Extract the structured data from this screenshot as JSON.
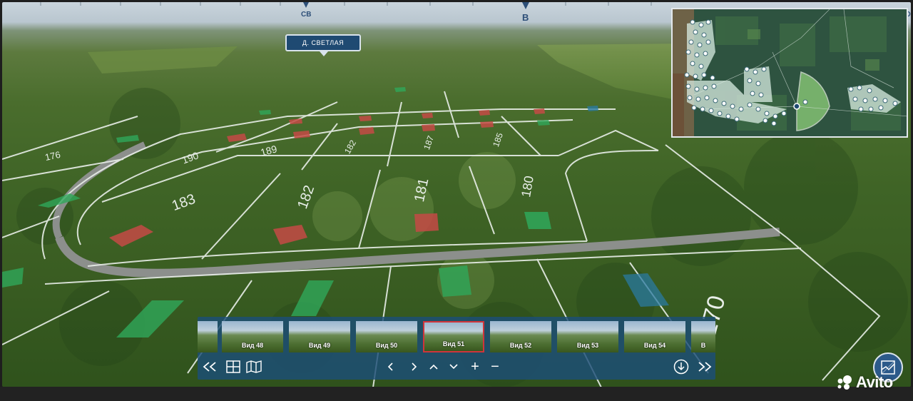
{
  "compass": {
    "ne_label": "СВ",
    "e_label": "В",
    "right_label": "О"
  },
  "village_label": "Д. СВЕТЛАЯ",
  "plot_numbers": [
    "180",
    "181",
    "182",
    "183",
    "189",
    "190",
    "176",
    "170",
    "185",
    "182",
    "187"
  ],
  "views": [
    {
      "label": ""
    },
    {
      "label": "Вид 48"
    },
    {
      "label": "Вид 49"
    },
    {
      "label": "Вид 50"
    },
    {
      "label": "Вид 51"
    },
    {
      "label": "Вид 52"
    },
    {
      "label": "Вид 53"
    },
    {
      "label": "Вид 54"
    },
    {
      "label": "В"
    }
  ],
  "active_view": "Вид 51",
  "controls": {
    "rewind": "rewind-icon",
    "grid": "grid-icon",
    "map": "map-icon",
    "prev": "chevron-left-icon",
    "next": "chevron-right-icon",
    "up": "chevron-up-icon",
    "down": "chevron-down-icon",
    "zoom_in": "+",
    "zoom_out": "−",
    "download": "download-icon",
    "forward": "fast-forward-icon"
  },
  "watermark": "Avito",
  "colors": {
    "panel": "#1c4e78",
    "active_border": "#d0343a",
    "plot_sold": "#c44a45",
    "plot_free": "#2fa85a",
    "plot_reserved": "#2a7aa0"
  }
}
